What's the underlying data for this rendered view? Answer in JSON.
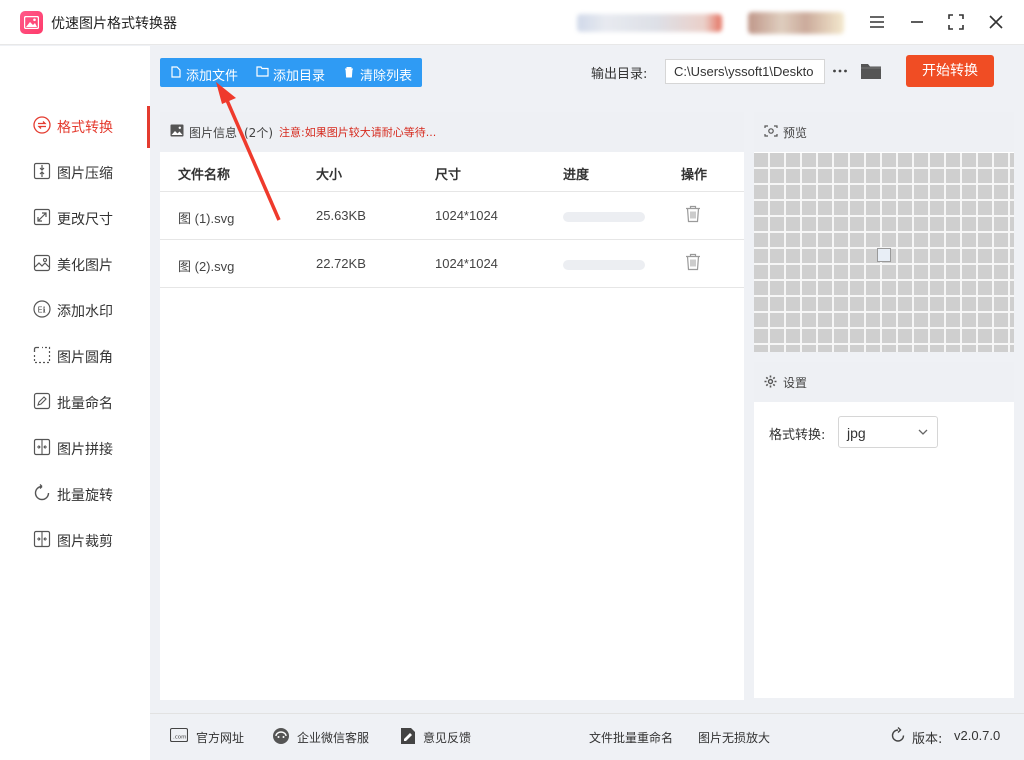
{
  "window": {
    "title": "优速图片格式转换器"
  },
  "sidebar": {
    "items": [
      {
        "label": "格式转换",
        "icon": "format-convert-icon",
        "active": true
      },
      {
        "label": "图片压缩",
        "icon": "compress-icon",
        "active": false
      },
      {
        "label": "更改尺寸",
        "icon": "resize-icon",
        "active": false
      },
      {
        "label": "美化图片",
        "icon": "beautify-icon",
        "active": false
      },
      {
        "label": "添加水印",
        "icon": "watermark-icon",
        "active": false
      },
      {
        "label": "图片圆角",
        "icon": "rounded-corner-icon",
        "active": false
      },
      {
        "label": "批量命名",
        "icon": "rename-icon",
        "active": false
      },
      {
        "label": "图片拼接",
        "icon": "stitch-icon",
        "active": false
      },
      {
        "label": "批量旋转",
        "icon": "rotate-icon",
        "active": false
      },
      {
        "label": "图片裁剪",
        "icon": "crop-icon",
        "active": false
      }
    ]
  },
  "toolbar": {
    "add_file": "添加文件",
    "add_folder": "添加目录",
    "clear_list": "清除列表",
    "output_label": "输出目录:",
    "output_path": "C:\\Users\\yssoft1\\Deskto",
    "start_button": "开始转换"
  },
  "file_panel": {
    "title": "图片信息",
    "count": "(2个)",
    "notice": "注意:如果图片较大请耐心等待...",
    "columns": [
      "文件名称",
      "大小",
      "尺寸",
      "进度",
      "操作"
    ],
    "rows": [
      {
        "name": "图 (1).svg",
        "size": "25.63KB",
        "dimensions": "1024*1024",
        "progress": 0
      },
      {
        "name": "图 (2).svg",
        "size": "22.72KB",
        "dimensions": "1024*1024",
        "progress": 0
      }
    ]
  },
  "preview": {
    "title": "预览"
  },
  "settings": {
    "title": "设置",
    "format_label": "格式转换:",
    "format_value": "jpg"
  },
  "footer": {
    "website": "官方网址",
    "wechat_service": "企业微信客服",
    "feedback": "意见反馈",
    "batch_rename": "文件批量重命名",
    "lossless_enlarge": "图片无损放大",
    "version_label": "版本:",
    "version": "v2.0.7.0"
  },
  "colors": {
    "accent_blue": "#2f9bf4",
    "start_orange": "#f04d24",
    "active_red": "#e43b2f",
    "notice_red": "#d62a1e"
  }
}
